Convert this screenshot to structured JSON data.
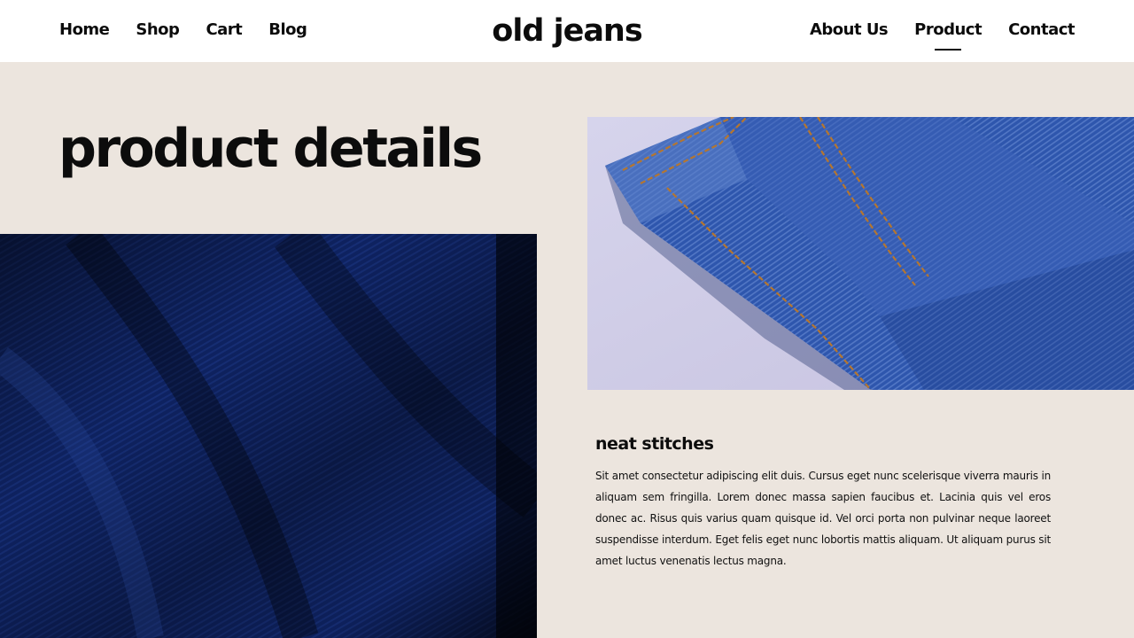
{
  "header": {
    "logo": "old jeans",
    "nav_left": [
      {
        "label": "Home"
      },
      {
        "label": "Shop"
      },
      {
        "label": "Cart"
      },
      {
        "label": "Blog"
      }
    ],
    "nav_right": [
      {
        "label": "About Us"
      },
      {
        "label": "Product",
        "active": true
      },
      {
        "label": "Contact"
      }
    ]
  },
  "main": {
    "title": "product details",
    "feature": {
      "title": "neat stitches",
      "description": "Sit amet consectetur adipiscing elit duis. Cursus eget nunc scelerisque viverra mauris in aliquam sem fringilla. Lorem donec massa sapien faucibus et. Lacinia quis vel eros donec ac. Risus quis varius quam quisque id. Vel orci porta non pulvinar neque laoreet suspendisse interdum. Eget felis eget nunc lobortis mattis aliquam. Ut aliquam purus sit amet luctus venenatis lectus magna."
    }
  },
  "colors": {
    "page_background": "#ece5de",
    "header_background": "#ffffff",
    "text": "#0c0c0c",
    "denim_dark": "#0b1d5c",
    "denim_light": "#2f55a8",
    "stitch": "#b5762f"
  }
}
